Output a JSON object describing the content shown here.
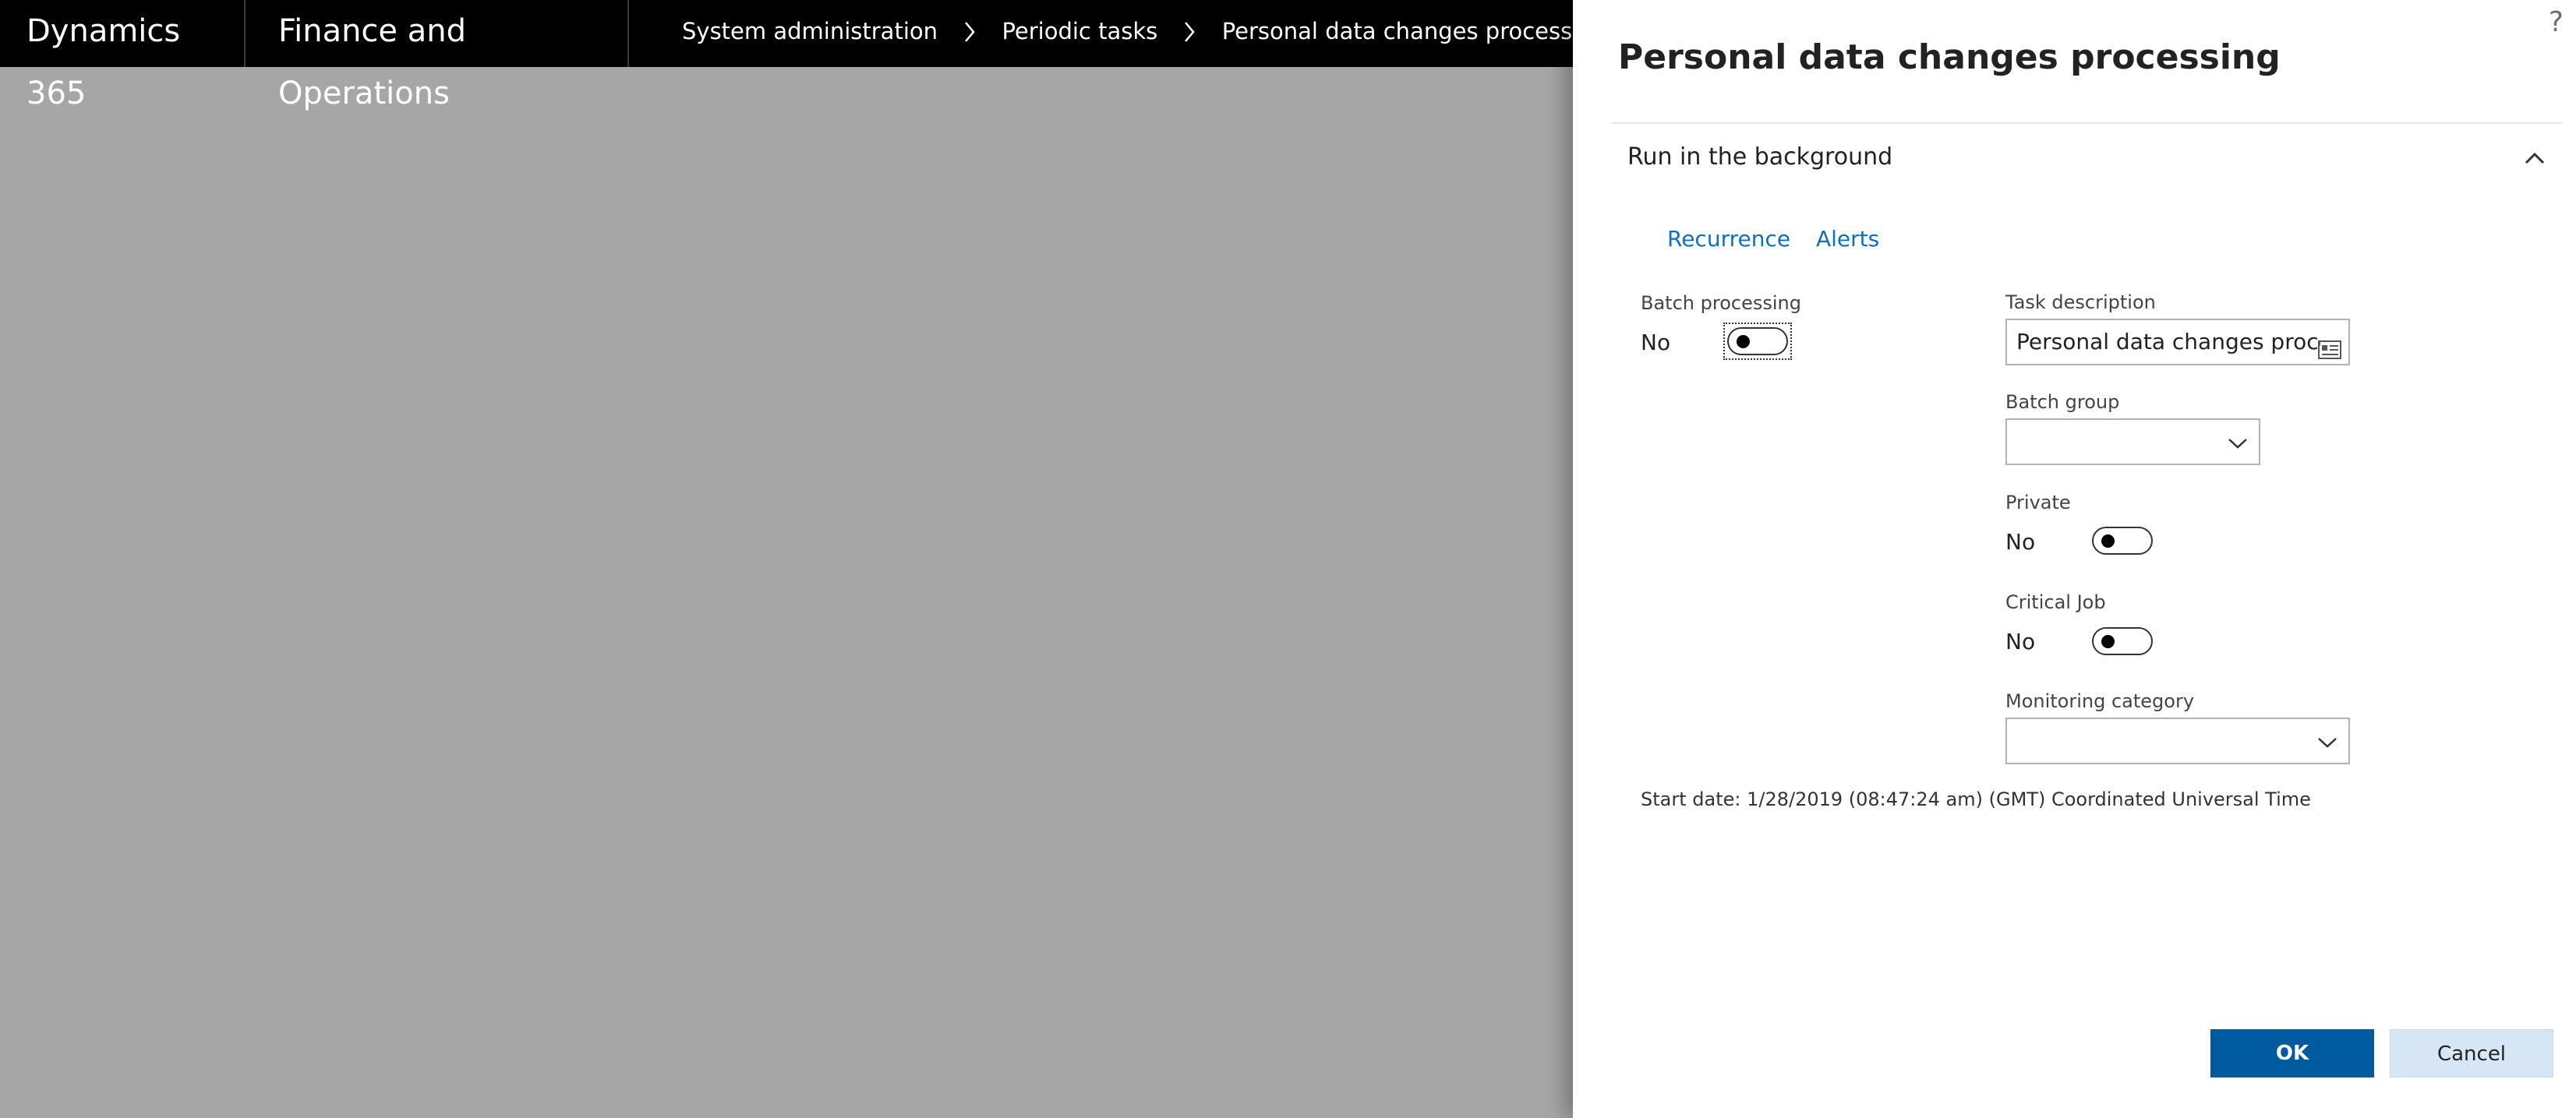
{
  "nav": {
    "product": "Dynamics 365",
    "app": "Finance and Operations",
    "breadcrumbs": [
      "System administration",
      "Periodic tasks",
      "Personal data changes processing"
    ]
  },
  "dialog": {
    "help": "?",
    "title": "Personal data changes processing",
    "section_title": "Run in the background",
    "tabs": [
      "Recurrence",
      "Alerts"
    ],
    "batch_processing": {
      "label": "Batch processing",
      "value": "No"
    },
    "task_description": {
      "label": "Task description",
      "value": "Personal data changes processing"
    },
    "batch_group": {
      "label": "Batch group",
      "value": ""
    },
    "private": {
      "label": "Private",
      "value": "No"
    },
    "critical_job": {
      "label": "Critical Job",
      "value": "No"
    },
    "monitoring_category": {
      "label": "Monitoring category",
      "value": ""
    },
    "start_date": "Start date: 1/28/2019 (08:47:24 am) (GMT) Coordinated Universal Time",
    "ok_label": "OK",
    "cancel_label": "Cancel"
  },
  "colors": {
    "topbar": "#000000",
    "overlay": "#a6a6a6",
    "link": "#106ebe",
    "primary": "#005a9e",
    "secondary": "#d6e6f4"
  }
}
